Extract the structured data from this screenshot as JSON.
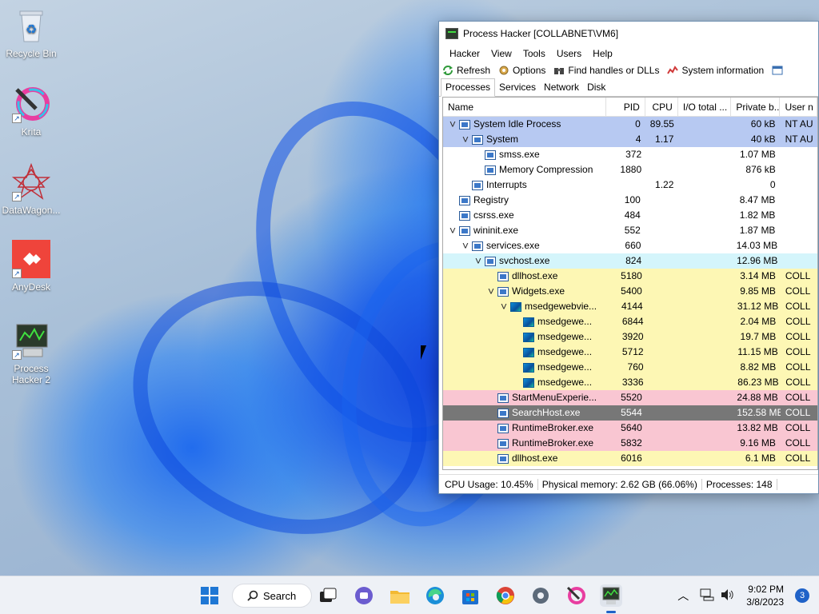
{
  "desktop": {
    "icons": [
      {
        "label": "Recycle Bin"
      },
      {
        "label": "Krita"
      },
      {
        "label": "DataWagon..."
      },
      {
        "label": "AnyDesk"
      },
      {
        "label": "Process Hacker 2"
      }
    ]
  },
  "window": {
    "title": "Process Hacker [COLLABNET\\VM6]",
    "menu": [
      "Hacker",
      "View",
      "Tools",
      "Users",
      "Help"
    ],
    "toolbar": {
      "refresh": "Refresh",
      "options": "Options",
      "find_handles": "Find handles or DLLs",
      "system_information": "System information"
    },
    "tabs": [
      "Processes",
      "Services",
      "Network",
      "Disk"
    ],
    "active_tab": "Processes",
    "columns": [
      "Name",
      "PID",
      "CPU",
      "I/O total ...",
      "Private b...",
      "User n"
    ],
    "processes": [
      {
        "name": "System Idle Process",
        "pid": "0",
        "cpu": "89.55",
        "io": "",
        "priv": "60 kB",
        "user": "NT AU",
        "depth": 0,
        "expander": "v",
        "bg": "#b7c9f2",
        "icon": "box"
      },
      {
        "name": "System",
        "pid": "4",
        "cpu": "1.17",
        "io": "",
        "priv": "40 kB",
        "user": "NT AU",
        "depth": 1,
        "expander": "v",
        "bg": "#b7c9f2",
        "icon": "box"
      },
      {
        "name": "smss.exe",
        "pid": "372",
        "cpu": "",
        "io": "",
        "priv": "1.07 MB",
        "user": "",
        "depth": 2,
        "expander": "",
        "bg": "#ffffff",
        "icon": "box"
      },
      {
        "name": "Memory Compression",
        "pid": "1880",
        "cpu": "",
        "io": "",
        "priv": "876 kB",
        "user": "",
        "depth": 2,
        "expander": "",
        "bg": "#ffffff",
        "icon": "box"
      },
      {
        "name": "Interrupts",
        "pid": "",
        "cpu": "1.22",
        "io": "",
        "priv": "0",
        "user": "",
        "depth": 1,
        "expander": "",
        "bg": "#ffffff",
        "icon": "box"
      },
      {
        "name": "Registry",
        "pid": "100",
        "cpu": "",
        "io": "",
        "priv": "8.47 MB",
        "user": "",
        "depth": 0,
        "expander": "",
        "bg": "#ffffff",
        "icon": "box"
      },
      {
        "name": "csrss.exe",
        "pid": "484",
        "cpu": "",
        "io": "",
        "priv": "1.82 MB",
        "user": "",
        "depth": 0,
        "expander": "",
        "bg": "#ffffff",
        "icon": "box"
      },
      {
        "name": "wininit.exe",
        "pid": "552",
        "cpu": "",
        "io": "",
        "priv": "1.87 MB",
        "user": "",
        "depth": 0,
        "expander": "v",
        "bg": "#ffffff",
        "icon": "box"
      },
      {
        "name": "services.exe",
        "pid": "660",
        "cpu": "",
        "io": "",
        "priv": "14.03 MB",
        "user": "",
        "depth": 1,
        "expander": "v",
        "bg": "#ffffff",
        "icon": "box"
      },
      {
        "name": "svchost.exe",
        "pid": "824",
        "cpu": "",
        "io": "",
        "priv": "12.96 MB",
        "user": "",
        "depth": 2,
        "expander": "v",
        "bg": "#d4f5fb",
        "icon": "box"
      },
      {
        "name": "dllhost.exe",
        "pid": "5180",
        "cpu": "",
        "io": "",
        "priv": "3.14 MB",
        "user": "COLL",
        "depth": 3,
        "expander": "",
        "bg": "#fdf7b4",
        "icon": "box"
      },
      {
        "name": "Widgets.exe",
        "pid": "5400",
        "cpu": "",
        "io": "",
        "priv": "9.85 MB",
        "user": "COLL",
        "depth": 3,
        "expander": "v",
        "bg": "#fdf7b4",
        "icon": "box"
      },
      {
        "name": "msedgewebvie...",
        "pid": "4144",
        "cpu": "",
        "io": "",
        "priv": "31.12 MB",
        "user": "COLL",
        "depth": 4,
        "expander": "v",
        "bg": "#fdf7b4",
        "icon": "edge"
      },
      {
        "name": "msedgewe...",
        "pid": "6844",
        "cpu": "",
        "io": "",
        "priv": "2.04 MB",
        "user": "COLL",
        "depth": 5,
        "expander": "",
        "bg": "#fdf7b4",
        "icon": "edge"
      },
      {
        "name": "msedgewe...",
        "pid": "3920",
        "cpu": "",
        "io": "",
        "priv": "19.7 MB",
        "user": "COLL",
        "depth": 5,
        "expander": "",
        "bg": "#fdf7b4",
        "icon": "edge"
      },
      {
        "name": "msedgewe...",
        "pid": "5712",
        "cpu": "",
        "io": "",
        "priv": "11.15 MB",
        "user": "COLL",
        "depth": 5,
        "expander": "",
        "bg": "#fdf7b4",
        "icon": "edge"
      },
      {
        "name": "msedgewe...",
        "pid": "760",
        "cpu": "",
        "io": "",
        "priv": "8.82 MB",
        "user": "COLL",
        "depth": 5,
        "expander": "",
        "bg": "#fdf7b4",
        "icon": "edge"
      },
      {
        "name": "msedgewe...",
        "pid": "3336",
        "cpu": "",
        "io": "",
        "priv": "86.23 MB",
        "user": "COLL",
        "depth": 5,
        "expander": "",
        "bg": "#fdf7b4",
        "icon": "edge"
      },
      {
        "name": "StartMenuExperie...",
        "pid": "5520",
        "cpu": "",
        "io": "",
        "priv": "24.88 MB",
        "user": "COLL",
        "depth": 3,
        "expander": "",
        "bg": "#f9c6d2",
        "icon": "box"
      },
      {
        "name": "SearchHost.exe",
        "pid": "5544",
        "cpu": "",
        "io": "",
        "priv": "152.58 MB",
        "user": "COLL",
        "depth": 3,
        "expander": "",
        "bg": "#777777",
        "icon": "box"
      },
      {
        "name": "RuntimeBroker.exe",
        "pid": "5640",
        "cpu": "",
        "io": "",
        "priv": "13.82 MB",
        "user": "COLL",
        "depth": 3,
        "expander": "",
        "bg": "#f9c6d2",
        "icon": "box"
      },
      {
        "name": "RuntimeBroker.exe",
        "pid": "5832",
        "cpu": "",
        "io": "",
        "priv": "9.16 MB",
        "user": "COLL",
        "depth": 3,
        "expander": "",
        "bg": "#f9c6d2",
        "icon": "box"
      },
      {
        "name": "dllhost.exe",
        "pid": "6016",
        "cpu": "",
        "io": "",
        "priv": "6.1 MB",
        "user": "COLL",
        "depth": 3,
        "expander": "",
        "bg": "#fdf7b4",
        "icon": "box"
      }
    ],
    "status": {
      "cpu_usage": "CPU Usage: 10.45%",
      "physical_memory": "Physical memory: 2.62 GB (66.06%)",
      "processes": "Processes: 148"
    }
  },
  "taskbar": {
    "search_label": "Search",
    "pinned": [
      "start-icon",
      "task-view-icon",
      "chat-icon",
      "file-explorer-icon",
      "edge-icon",
      "store-icon",
      "chrome-icon",
      "settings-icon",
      "krita-icon",
      "process-hacker-icon"
    ],
    "clock_time": "9:02 PM",
    "clock_date": "3/8/2023",
    "notifications": "3"
  }
}
